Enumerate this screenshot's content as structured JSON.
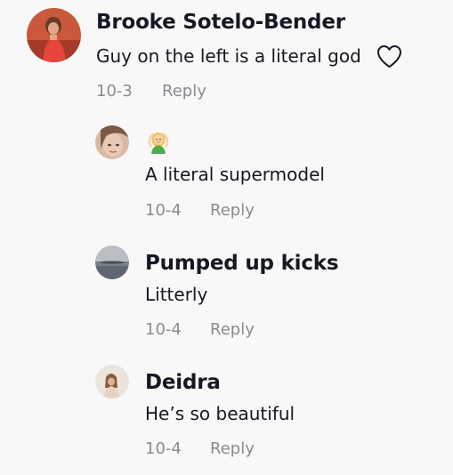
{
  "comments": [
    {
      "author": "Brooke Sotelo-Bender",
      "text": "Guy on the left is a literal god",
      "date": "10-3",
      "reply_label": "Reply"
    }
  ],
  "replies": [
    {
      "author": "",
      "author_icon": "woman-gesturing-ok-emoji",
      "text": "A literal supermodel",
      "date": "10-4",
      "reply_label": "Reply"
    },
    {
      "author": "Pumped up kicks",
      "text": "Litterly",
      "date": "10-4",
      "reply_label": "Reply"
    },
    {
      "author": "Deidra",
      "text": "He’s so beautiful",
      "date": "10-4",
      "reply_label": "Reply"
    }
  ],
  "icons": {
    "like": "heart-outline-icon"
  },
  "colors": {
    "background": "#f8f8f8",
    "primary_text": "#161823",
    "secondary_text": "#8a8b91"
  }
}
